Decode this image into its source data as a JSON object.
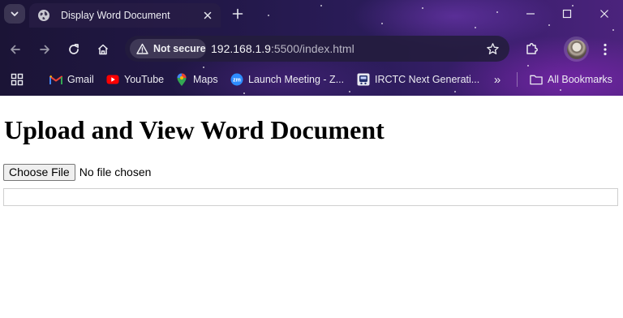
{
  "browser": {
    "tab": {
      "title": "Display Word Document"
    },
    "omnibox": {
      "security_label": "Not secure",
      "url_host": "192.168.1.9",
      "url_path": ":5500/index.html"
    },
    "bookmarks": [
      {
        "label": "Gmail",
        "icon": "gmail-icon"
      },
      {
        "label": "YouTube",
        "icon": "youtube-icon"
      },
      {
        "label": "Maps",
        "icon": "maps-icon"
      },
      {
        "label": "Launch Meeting - Z...",
        "icon": "zoom-icon"
      },
      {
        "label": "IRCTC Next Generati...",
        "icon": "irctc-icon"
      }
    ],
    "overflow_label": "»",
    "all_bookmarks_label": "All Bookmarks"
  },
  "page": {
    "heading": "Upload and View Word Document",
    "file_input": {
      "button_label": "Choose File",
      "status": "No file chosen"
    }
  },
  "colors": {
    "youtube": "#ff0000",
    "zoom": "#2d8cff",
    "gmail_red": "#ea4335"
  }
}
